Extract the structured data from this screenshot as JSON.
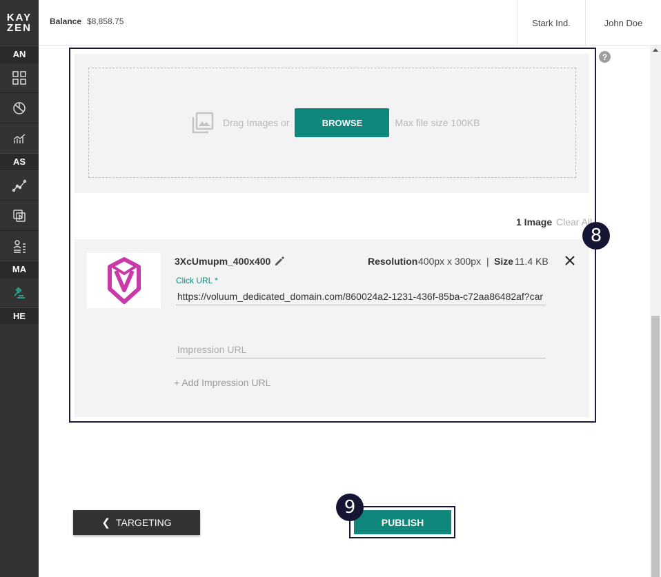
{
  "sidebar": {
    "logo_top": "KAY",
    "logo_bottom": "ZEN",
    "sections": [
      "AN",
      "AS",
      "MA",
      "HE"
    ],
    "accent": "#1fbfa9"
  },
  "header": {
    "balance_label": "Balance",
    "balance_value": "$8,858.75",
    "company": "Stark Ind.",
    "user": "John Doe"
  },
  "upload": {
    "help_label": "?",
    "drag_text": "Drag Images or",
    "browse_label": "BROWSE",
    "max_text": "Max file size 100KB"
  },
  "images": {
    "count_text": "1 Image",
    "clear_label": "Clear All",
    "item": {
      "name": "3XcUmupm_400x400",
      "resolution_label": "Resolution",
      "resolution_value": "400px x 300px",
      "separator": "|",
      "size_label": "Size",
      "size_value": "11.4 KB",
      "click_url_label": "Click URL *",
      "click_url_value": "https://voluum_dedicated_domain.com/860024a2-1231-436f-85ba-c72aa86482af?car",
      "impression_placeholder": "Impression URL",
      "add_impression_label": "+ Add Impression URL"
    }
  },
  "steps": {
    "step8": "8",
    "step9": "9"
  },
  "footer": {
    "back_label": "TARGETING",
    "publish_label": "PUBLISH"
  },
  "colors": {
    "primary": "#0f877b",
    "sidebar_bg": "#333333",
    "badge": "#141633"
  }
}
